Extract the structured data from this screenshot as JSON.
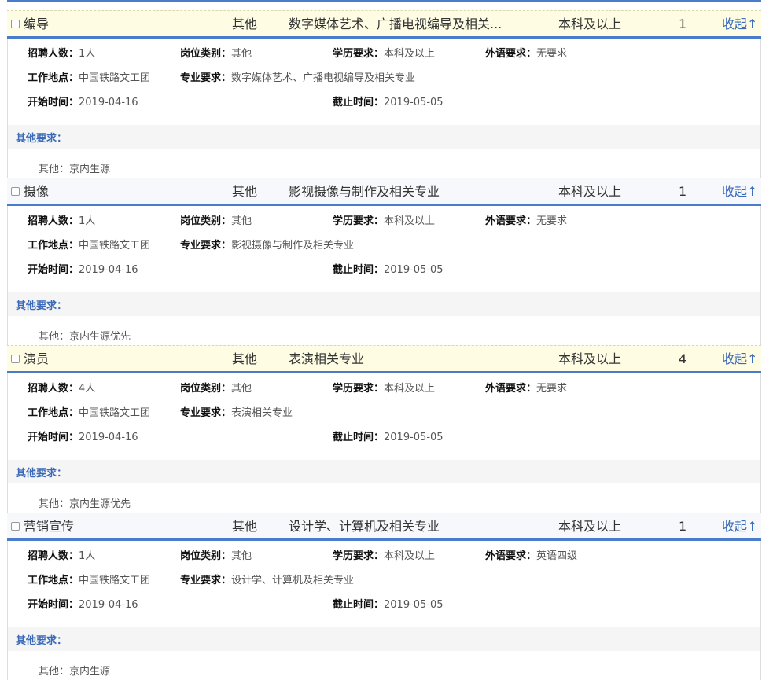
{
  "labels": {
    "count": "招聘人数：",
    "category": "岗位类别：",
    "education": "学历要求：",
    "language": "外语要求：",
    "location": "工作地点：",
    "major": "专业要求：",
    "start": "开始时间：",
    "end": "截止时间：",
    "other": "其他要求："
  },
  "jobs": [
    {
      "title": "编导",
      "category": "其他",
      "major_short": "数字媒体艺术、广播电视编导及相关...",
      "education": "本科及以上",
      "count": "1",
      "toggle": "收起↑",
      "count_detail": "1人",
      "category_detail": "其他",
      "education_detail": "本科及以上",
      "language": "无要求",
      "location": "中国铁路文工团",
      "major": "数字媒体艺术、广播电视编导及相关专业",
      "start": "2019-04-16",
      "end": "2019-05-05",
      "other": "其他：京内生源"
    },
    {
      "title": "摄像",
      "category": "其他",
      "major_short": "影视摄像与制作及相关专业",
      "education": "本科及以上",
      "count": "1",
      "toggle": "收起↑",
      "count_detail": "1人",
      "category_detail": "其他",
      "education_detail": "本科及以上",
      "language": "无要求",
      "location": "中国铁路文工团",
      "major": "影视摄像与制作及相关专业",
      "start": "2019-04-16",
      "end": "2019-05-05",
      "other": "其他：京内生源优先"
    },
    {
      "title": "演员",
      "category": "其他",
      "major_short": "表演相关专业",
      "education": "本科及以上",
      "count": "4",
      "toggle": "收起↑",
      "count_detail": "4人",
      "category_detail": "其他",
      "education_detail": "本科及以上",
      "language": "无要求",
      "location": "中国铁路文工团",
      "major": "表演相关专业",
      "start": "2019-04-16",
      "end": "2019-05-05",
      "other": "其他：京内生源优先"
    },
    {
      "title": "营销宣传",
      "category": "其他",
      "major_short": "设计学、计算机及相关专业",
      "education": "本科及以上",
      "count": "1",
      "toggle": "收起↑",
      "count_detail": "1人",
      "category_detail": "其他",
      "education_detail": "本科及以上",
      "language": "英语四级",
      "location": "中国铁路文工团",
      "major": "设计学、计算机及相关专业",
      "start": "2019-04-16",
      "end": "2019-05-05",
      "other": "其他：京内生源"
    }
  ]
}
